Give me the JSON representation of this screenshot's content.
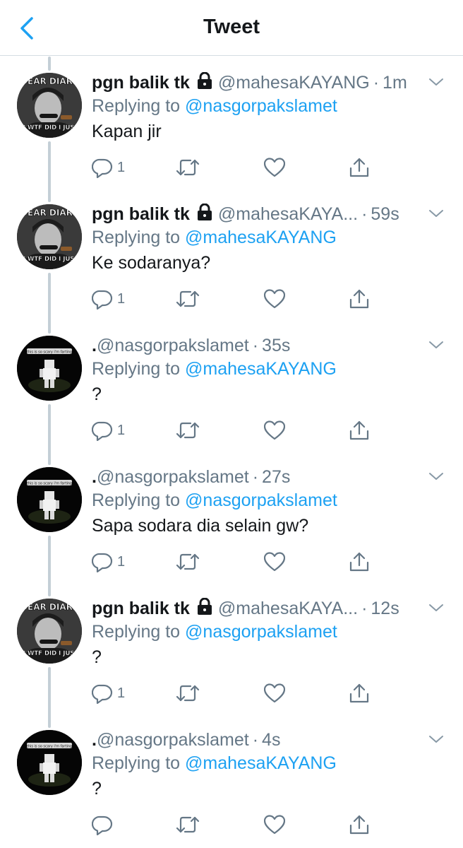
{
  "header": {
    "title": "Tweet"
  },
  "colors": {
    "link": "#1da1f2",
    "muted": "#657786",
    "text": "#14171a",
    "divider": "#d5dde3"
  },
  "tweets": [
    {
      "name": "pgn balik tk",
      "locked": true,
      "handle": "@mahesaKAYANG",
      "time": "1m",
      "reply_prefix": "Replying to",
      "reply_to": "@nasgorpakslamet",
      "text": "Kapan jir",
      "reply_count": "1",
      "avatar": "meme"
    },
    {
      "name": "pgn balik tk",
      "locked": true,
      "handle": "@mahesaKAYA...",
      "time": "59s",
      "reply_prefix": "Replying to",
      "reply_to": "@mahesaKAYANG",
      "text": "Ke sodaranya?",
      "reply_count": "1",
      "avatar": "meme"
    },
    {
      "name": ".",
      "locked": false,
      "handle": "@nasgorpakslamet",
      "time": "35s",
      "reply_prefix": "Replying to",
      "reply_to": "@mahesaKAYANG",
      "text": "?",
      "reply_count": "1",
      "avatar": "dark",
      "avatar_caption": "this is so scary i'm farting"
    },
    {
      "name": ".",
      "locked": false,
      "handle": "@nasgorpakslamet",
      "time": "27s",
      "reply_prefix": "Replying to",
      "reply_to": "@nasgorpakslamet",
      "text": "Sapa sodara dia selain gw?",
      "reply_count": "1",
      "avatar": "dark",
      "avatar_caption": "this is so scary i'm farting"
    },
    {
      "name": "pgn balik tk",
      "locked": true,
      "handle": "@mahesaKAYA...",
      "time": "12s",
      "reply_prefix": "Replying to",
      "reply_to": "@nasgorpakslamet",
      "text": "?",
      "reply_count": "1",
      "avatar": "meme"
    },
    {
      "name": ".",
      "locked": false,
      "handle": "@nasgorpakslamet",
      "time": "4s",
      "reply_prefix": "Replying to",
      "reply_to": "@mahesaKAYANG",
      "text": "?",
      "reply_count": "",
      "avatar": "dark",
      "avatar_caption": "this is so scary i'm farting"
    }
  ],
  "meme_avatar": {
    "top_text": "DEAR DIARY",
    "bottom_text": "TODAY WTF DID I JUST SAW"
  },
  "icons": {
    "back": "chevron-left-icon",
    "reply": "reply-icon",
    "retweet": "retweet-icon",
    "like": "heart-icon",
    "share": "share-icon",
    "caret": "chevron-down-icon",
    "lock": "lock-icon"
  }
}
